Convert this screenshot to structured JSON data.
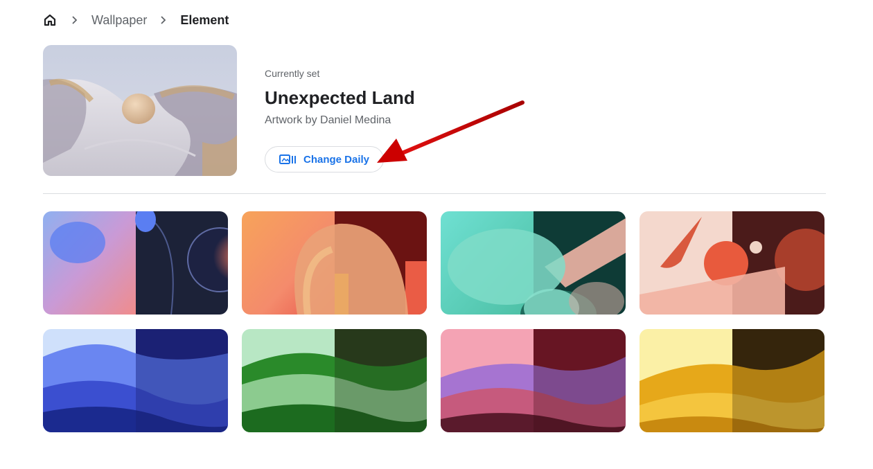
{
  "breadcrumb": {
    "home_icon": "home-icon",
    "separator_icon": "chevron-right-icon",
    "items": [
      "Wallpaper",
      "Element"
    ]
  },
  "current": {
    "label": "Currently set",
    "title": "Unexpected Land",
    "artist": "Artwork by Daniel Medina"
  },
  "button": {
    "label": "Change Daily",
    "icon": "change-daily-icon"
  },
  "colors": {
    "accent": "#1a73e8",
    "annotation_arrow": "#cc0000",
    "divider": "#dadce0"
  },
  "wallpapers": [
    {
      "name": "wallpaper-purple-glass"
    },
    {
      "name": "wallpaper-orange-arch"
    },
    {
      "name": "wallpaper-teal-shapes"
    },
    {
      "name": "wallpaper-peach-spheres"
    },
    {
      "name": "wallpaper-blue-wave"
    },
    {
      "name": "wallpaper-green-wave"
    },
    {
      "name": "wallpaper-pink-wave"
    },
    {
      "name": "wallpaper-yellow-wave"
    }
  ]
}
